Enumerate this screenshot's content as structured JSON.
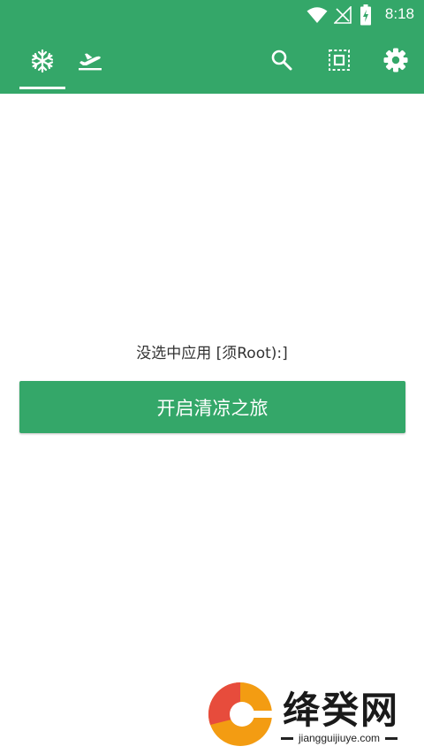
{
  "status_bar": {
    "time": "8:18",
    "icons": [
      "wifi-icon",
      "signal-no-sim-icon",
      "battery-charging-icon"
    ]
  },
  "toolbar": {
    "tabs": [
      {
        "icon": "snowflake-icon",
        "selected": true
      },
      {
        "icon": "airplane-takeoff-icon",
        "selected": false
      }
    ],
    "actions": [
      "search-icon",
      "select-all-icon",
      "settings-gear-icon"
    ]
  },
  "main": {
    "message": "没选中应用 [须Root):]",
    "start_button_label": "开启清凉之旅"
  },
  "watermark": {
    "logo_text": "绛癸网",
    "url": "jiangguijiuye.com"
  },
  "colors": {
    "primary": "#34a769",
    "text": "#333333",
    "background": "#ffffff"
  }
}
